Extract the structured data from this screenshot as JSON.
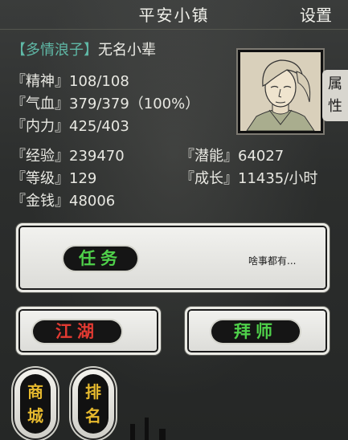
{
  "header": {
    "title": "平安小镇",
    "settings_label": "设置"
  },
  "player": {
    "title_tag": "【多情浪子】",
    "name": "无名小辈",
    "jingshen": {
      "label": "『精神』",
      "value": "108/108"
    },
    "qixue": {
      "label": "『气血』",
      "value": "379/379（100%）"
    },
    "neili": {
      "label": "『内力』",
      "value": "425/403"
    },
    "jingyan": {
      "label": "『经验』",
      "value": "239470"
    },
    "qianneng": {
      "label": "『潜能』",
      "value": "64027"
    },
    "dengji": {
      "label": "『等级』",
      "value": "129"
    },
    "chengzhang": {
      "label": "『成长』",
      "value": "11435/小时"
    },
    "jinqian": {
      "label": "『金钱』",
      "value": "48006"
    }
  },
  "attr_tab_label": "属性",
  "mission": {
    "label": "任务",
    "status": "啥事都有..."
  },
  "buttons": {
    "jianghu": "江湖",
    "baishi": "拜师",
    "shangcheng": "商城",
    "paiming": "排名"
  },
  "colors": {
    "title_tag": "#5fb8a6",
    "mission_text": "#4fd14a",
    "jianghu_text": "#e23a32",
    "baishi_text": "#4fd14a",
    "side_btn_text": "#e6b92e"
  }
}
